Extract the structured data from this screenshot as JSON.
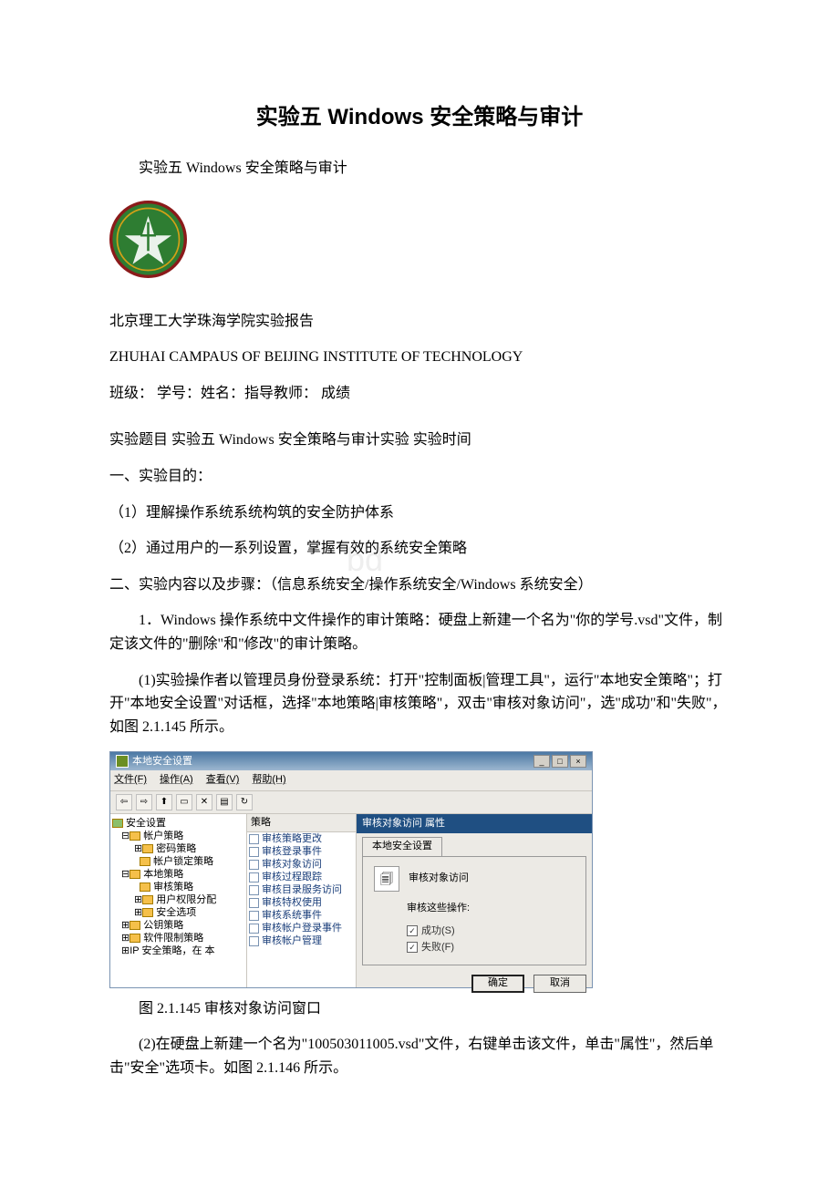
{
  "title_main": "实验五 Windows 安全策略与审计",
  "subtitle_repeat": "实验五 Windows 安全策略与审计",
  "report_header": "北京理工大学珠海学院实验报告",
  "report_header_en": "ZHUHAI CAMPAUS OF BEIJING INSTITUTE OF TECHNOLOGY",
  "class_line": "班级： 学号：姓名：指导教师： 成绩",
  "topic_line": "实验题目 实验五 Windows 安全策略与审计实验 实验时间",
  "section1": "一、实验目的：",
  "purpose1": "（1）理解操作系统系统构筑的安全防护体系",
  "purpose2": "（2）通过用户的一系列设置，掌握有效的系统安全策略",
  "watermark": "bd",
  "section2": "二、实验内容以及步骤：（信息系统安全/操作系统安全/Windows 系统安全）",
  "step1": "1．Windows 操作系统中文件操作的审计策略：硬盘上新建一个名为\"你的学号.vsd\"文件，制定该文件的\"删除\"和\"修改\"的审计策略。",
  "step1_1": "(1)实验操作者以管理员身份登录系统：打开\"控制面板|管理工具\"，运行\"本地安全策略\"；打开\"本地安全设置\"对话框，选择\"本地策略|审核策略\"，双击\"审核对象访问\"，选\"成功\"和\"失败\"，如图 2.1.145 所示。",
  "fig_caption": "图 2.1.145 审核对象访问窗口",
  "step1_2": "(2)在硬盘上新建一个名为\"100503011005.vsd\"文件，右键单击该文件，单击\"属性\"，然后单击\"安全\"选项卡。如图 2.1.146 所示。",
  "win": {
    "title": "本地安全设置",
    "sys": {
      "min": "_",
      "max": "□",
      "close": "×"
    },
    "menu": {
      "file": "文件(F)",
      "action": "操作(A)",
      "view": "查看(V)",
      "help": "帮助(H)"
    },
    "tree": {
      "root": "安全设置",
      "n1": "帐户策略",
      "n1a": "密码策略",
      "n1b": "帐户锁定策略",
      "n2": "本地策略",
      "n2a": "审核策略",
      "n2b": "用户权限分配",
      "n2c": "安全选项",
      "n3": "公钥策略",
      "n4": "软件限制策略",
      "n5": "IP 安全策略，在 本"
    },
    "list_header": "策略",
    "list": {
      "i1": "审核策略更改",
      "i2": "审核登录事件",
      "i3": "审核对象访问",
      "i4": "审核过程跟踪",
      "i5": "审核目录服务访问",
      "i6": "审核特权使用",
      "i7": "审核系统事件",
      "i8": "审核帐户登录事件",
      "i9": "审核帐户管理"
    },
    "dlg": {
      "title": "审核对象访问 属性",
      "tab": "本地安全设置",
      "label": "审核对象访问",
      "ops": "审核这些操作:",
      "success": "成功(S)",
      "failure": "失败(F)",
      "ok": "确定",
      "cancel": "取消"
    }
  }
}
